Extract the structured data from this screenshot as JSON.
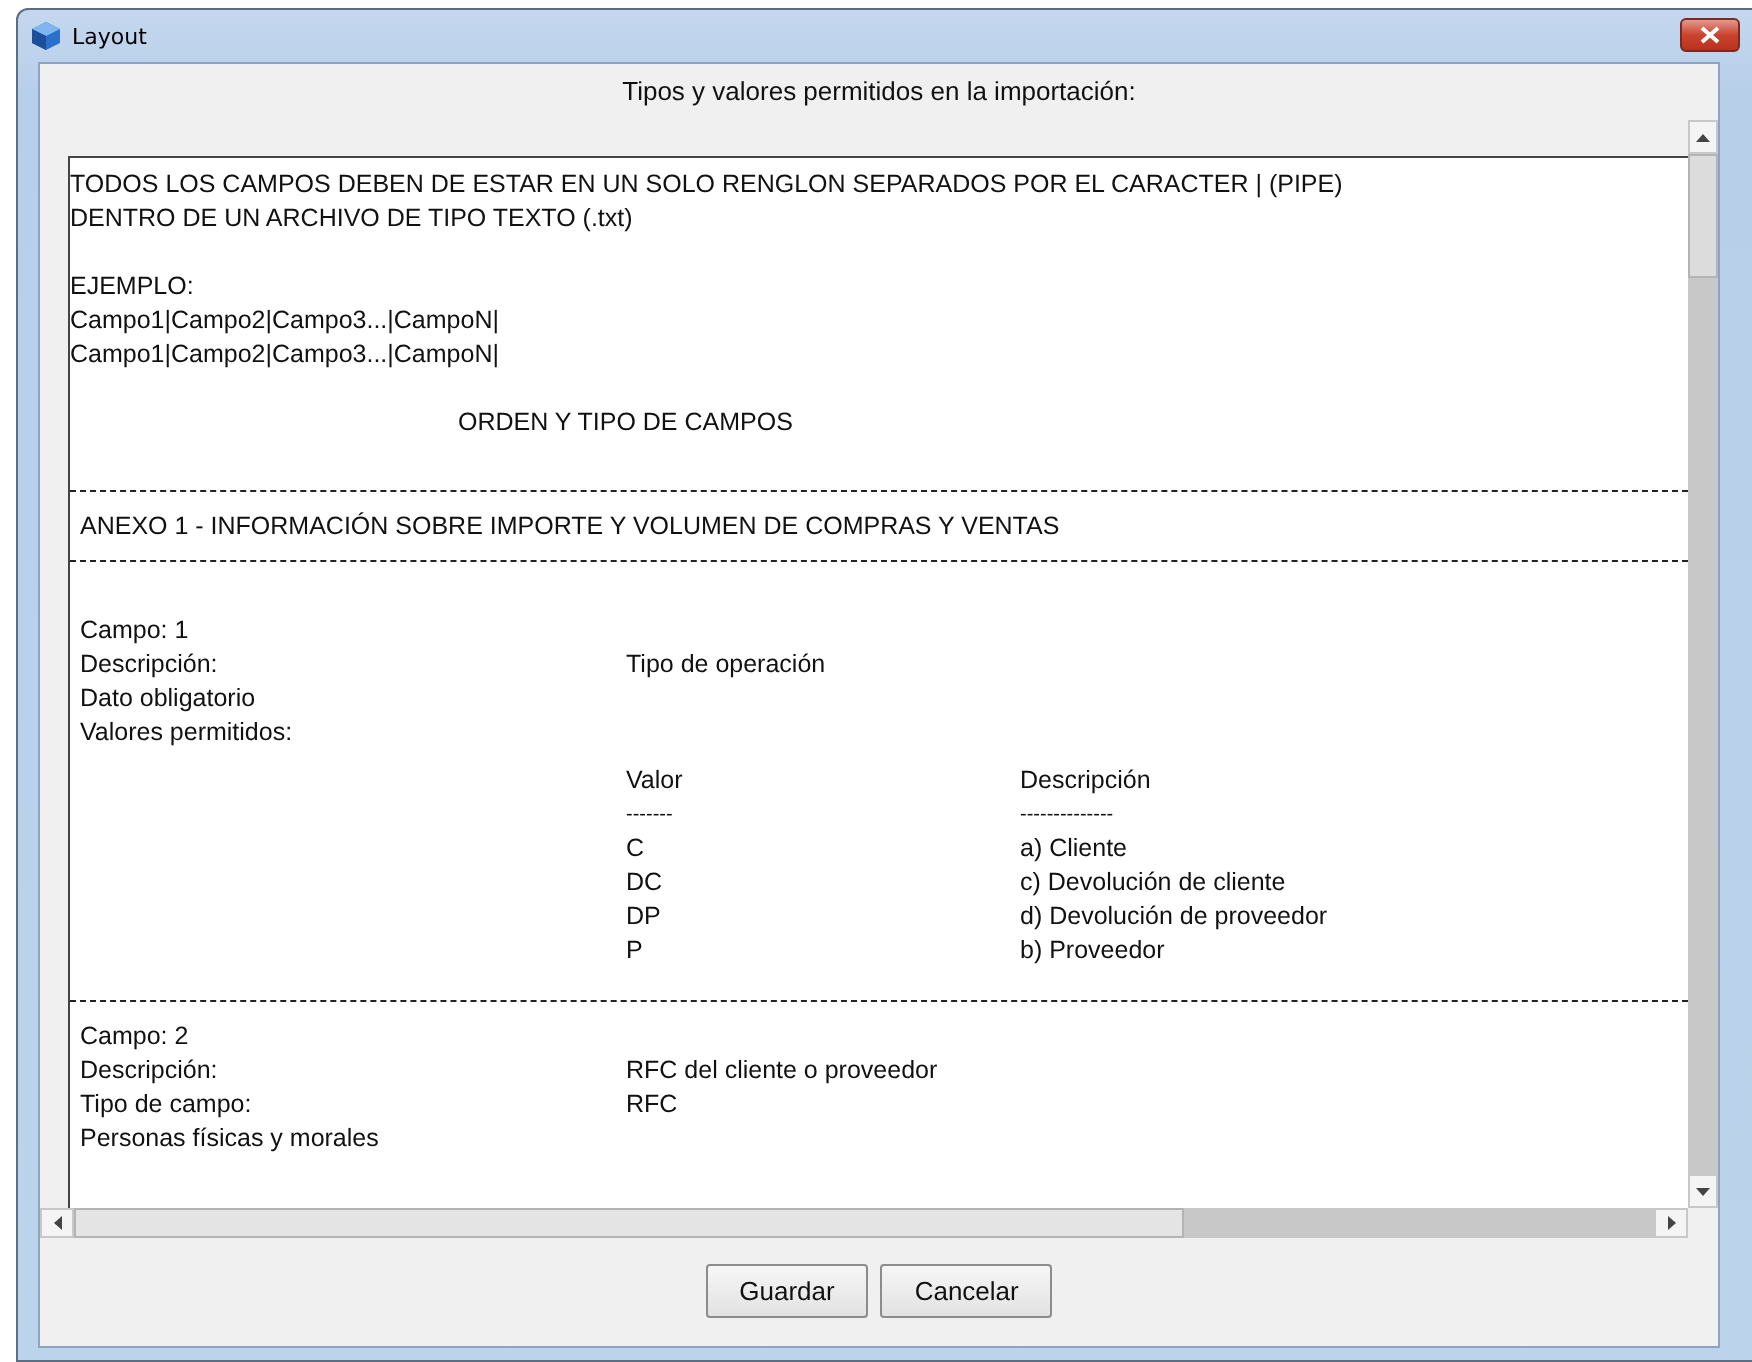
{
  "window": {
    "title": "Layout"
  },
  "heading": "Tipos y valores permitidos en la importación:",
  "document": {
    "intro": [
      "TODOS LOS CAMPOS DEBEN DE ESTAR EN UN SOLO RENGLON SEPARADOS POR EL CARACTER | (PIPE)",
      "DENTRO DE UN ARCHIVO DE TIPO TEXTO (.txt)"
    ],
    "example_label": "EJEMPLO:",
    "example_lines": [
      "Campo1|Campo2|Campo3...|CampoN|",
      "Campo1|Campo2|Campo3...|CampoN|"
    ],
    "section_heading": "ORDEN Y TIPO DE CAMPOS",
    "annex_title": "ANEXO 1 - INFORMACIÓN SOBRE IMPORTE Y VOLUMEN DE COMPRAS Y VENTAS",
    "fields": [
      {
        "rows": [
          {
            "label": "Campo: 1"
          },
          {
            "label": "Descripción:",
            "value": "Tipo de operación"
          },
          {
            "label": "Dato obligatorio"
          },
          {
            "label": "Valores permitidos:"
          }
        ],
        "values_table": {
          "headers": [
            "Valor",
            "Descripción"
          ],
          "underlines": [
            "-------",
            "--------------"
          ],
          "rows": [
            [
              "C",
              "a) Cliente"
            ],
            [
              "DC",
              "c) Devolución de cliente"
            ],
            [
              "DP",
              "d) Devolución de proveedor"
            ],
            [
              "P",
              "b) Proveedor"
            ]
          ]
        }
      },
      {
        "rows": [
          {
            "label": "Campo: 2"
          },
          {
            "label": "Descripción:",
            "value": "RFC del cliente o proveedor"
          },
          {
            "label": "Tipo de campo:",
            "value": "RFC"
          },
          {
            "label": "Personas físicas y morales"
          }
        ]
      }
    ]
  },
  "buttons": [
    "Guardar",
    "Cancelar"
  ]
}
